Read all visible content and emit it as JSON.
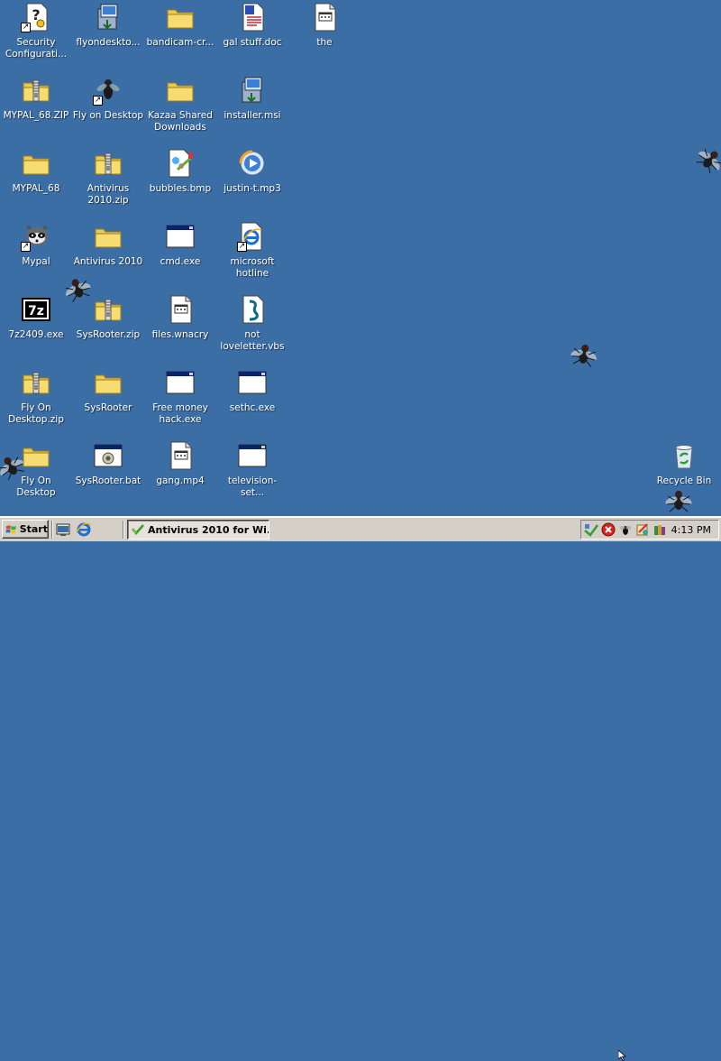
{
  "desktop": {
    "background": "#3a6ea5",
    "icons": [
      {
        "label": "Security Configurati...",
        "icon": "security-config-icon",
        "shortcut": true
      },
      {
        "label": "flyondeskto...",
        "icon": "installer-icon",
        "shortcut": false
      },
      {
        "label": "bandicam-cr...",
        "icon": "folder-icon",
        "shortcut": false
      },
      {
        "label": "gal stuff.doc",
        "icon": "document-icon",
        "shortcut": false
      },
      {
        "label": "the",
        "icon": "generic-file-icon",
        "shortcut": false
      },
      {
        "label": "MYPAL_68.ZIP",
        "icon": "zip-folder-icon",
        "shortcut": false
      },
      {
        "label": "Fly on Desktop",
        "icon": "fly-icon",
        "shortcut": true
      },
      {
        "label": "Kazaa Shared Downloads",
        "icon": "folder-icon",
        "shortcut": false
      },
      {
        "label": "installer.msi",
        "icon": "installer-icon",
        "shortcut": false
      },
      {
        "label": "MYPAL_68",
        "icon": "folder-icon",
        "shortcut": false
      },
      {
        "label": "Antivirus 2010.zip",
        "icon": "zip-folder-icon",
        "shortcut": false
      },
      {
        "label": "bubbles.bmp",
        "icon": "bitmap-icon",
        "shortcut": false
      },
      {
        "label": "justin-t.mp3",
        "icon": "media-icon",
        "shortcut": false
      },
      {
        "label": "Mypal",
        "icon": "raccoon-icon",
        "shortcut": true
      },
      {
        "label": "Antivirus 2010",
        "icon": "folder-icon",
        "shortcut": false
      },
      {
        "label": "cmd.exe",
        "icon": "window-exe-icon",
        "shortcut": false
      },
      {
        "label": "microsoft hotline",
        "icon": "internet-shortcut-icon",
        "shortcut": true
      },
      {
        "label": "7z2409.exe",
        "icon": "sevenzip-icon",
        "shortcut": false
      },
      {
        "label": "SysRooter.zip",
        "icon": "zip-folder-icon",
        "shortcut": false
      },
      {
        "label": "files.wnacry",
        "icon": "generic-file-icon",
        "shortcut": false
      },
      {
        "label": "not loveletter.vbs",
        "icon": "script-icon",
        "shortcut": false
      },
      {
        "label": "Fly On Desktop.zip",
        "icon": "zip-folder-icon",
        "shortcut": false
      },
      {
        "label": "SysRooter",
        "icon": "folder-icon",
        "shortcut": false
      },
      {
        "label": "Free money hack.exe",
        "icon": "window-exe-icon",
        "shortcut": false
      },
      {
        "label": "sethc.exe",
        "icon": "window-exe-icon",
        "shortcut": false
      },
      {
        "label": "Fly On Desktop",
        "icon": "folder-icon",
        "shortcut": false
      },
      {
        "label": "SysRooter.bat",
        "icon": "batch-icon",
        "shortcut": false
      },
      {
        "label": "gang.mp4",
        "icon": "generic-file-icon",
        "shortcut": false
      },
      {
        "label": "television-set...",
        "icon": "window-exe-icon",
        "shortcut": false
      },
      {
        "label": "Recycle Bin",
        "icon": "recycle-bin-icon",
        "shortcut": false
      }
    ],
    "flies": 6
  },
  "taskbar": {
    "start_label": "Start",
    "quick_launch": [
      "show-desktop-icon",
      "internet-explorer-icon"
    ],
    "tasks": [
      {
        "label": "Antivirus 2010 for Wi...",
        "icon": "antivirus-icon",
        "active": true
      }
    ],
    "tray_icons": [
      "network-icon",
      "error-icon",
      "fly-tray-icon",
      "security-tray-icon",
      "books-tray-icon"
    ],
    "clock": "4:13 PM"
  },
  "colors": {
    "desktop": "#3a6ea5",
    "taskbar": "#d4d0c8",
    "folder": "#f5d96b"
  }
}
